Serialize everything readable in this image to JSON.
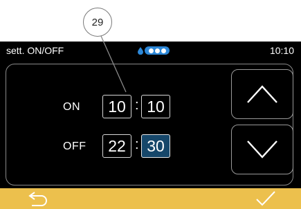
{
  "callout": {
    "number": "29"
  },
  "statusbar": {
    "title": "sett. ON/OFF",
    "time": "10:10"
  },
  "timer": {
    "on": {
      "label": "ON",
      "hours": "10",
      "minutes": "10"
    },
    "off": {
      "label": "OFF",
      "hours": "22",
      "minutes": "30"
    },
    "separator": ":",
    "selected_field": "off.minutes"
  },
  "buttons": {
    "up": "arrow-up-icon",
    "down": "arrow-down-icon",
    "back": "back-icon",
    "confirm": "check-icon"
  },
  "colors": {
    "screen_bg": "#000000",
    "bottom_bar": "#ecc04d",
    "selected_field_bg": "#16476a",
    "status_accent": "#2d88d8"
  }
}
